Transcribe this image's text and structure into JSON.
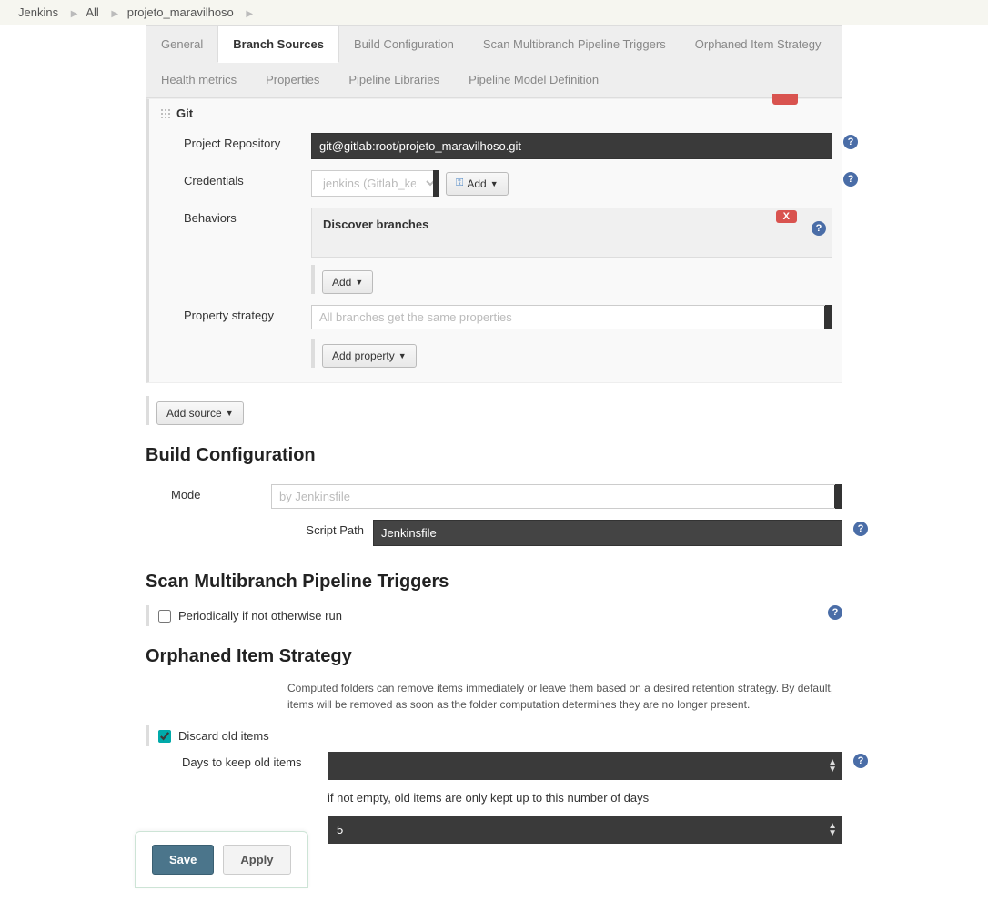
{
  "breadcrumbs": [
    "Jenkins",
    "All",
    "projeto_maravilhoso"
  ],
  "tabs_row1": [
    "General",
    "Branch Sources",
    "Build Configuration",
    "Scan Multibranch Pipeline Triggers",
    "Orphaned Item Strategy"
  ],
  "tabs_row2": [
    "Health metrics",
    "Properties",
    "Pipeline Libraries",
    "Pipeline Model Definition"
  ],
  "active_tab": "Branch Sources",
  "git": {
    "title": "Git",
    "repo_label": "Project Repository",
    "repo_value": "git@gitlab:root/projeto_maravilhoso.git",
    "cred_label": "Credentials",
    "cred_value": "jenkins (Gitlab_key)",
    "add_btn": "Add",
    "behaviors_label": "Behaviors",
    "behavior_title": "Discover branches",
    "behavior_x": "X",
    "behavior_add": "Add",
    "prop_strategy_label": "Property strategy",
    "prop_strategy_value": "All branches get the same properties",
    "add_property": "Add property",
    "add_source": "Add source"
  },
  "build": {
    "heading": "Build Configuration",
    "mode_label": "Mode",
    "mode_value": "by Jenkinsfile",
    "script_label": "Script Path",
    "script_value": "Jenkinsfile"
  },
  "scan": {
    "heading": "Scan Multibranch Pipeline Triggers",
    "periodic_label": "Periodically if not otherwise run"
  },
  "orphan": {
    "heading": "Orphaned Item Strategy",
    "desc": "Computed folders can remove items immediately or leave them based on a desired retention strategy. By default, items will be removed as soon as the folder computation determines they are no longer present.",
    "discard_label": "Discard old items",
    "days_label": "Days to keep old items",
    "days_hint": "if not empty, old items are only kept up to this number of days",
    "max_value": "5",
    "truncated_label": ""
  },
  "buttons": {
    "save": "Save",
    "apply": "Apply"
  }
}
